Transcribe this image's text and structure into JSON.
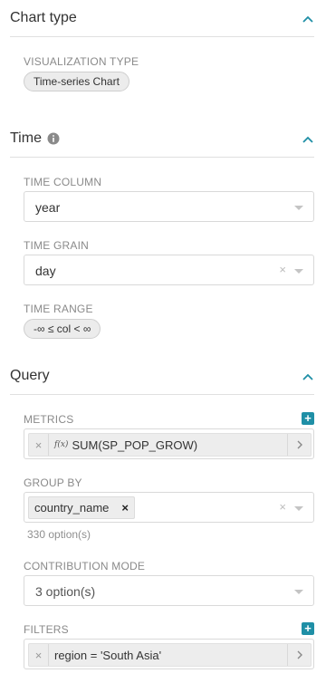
{
  "sections": {
    "chart_type": {
      "title": "Chart type"
    },
    "time": {
      "title": "Time"
    },
    "query": {
      "title": "Query"
    }
  },
  "visualization": {
    "label": "VISUALIZATION TYPE",
    "value": "Time-series Chart"
  },
  "time_column": {
    "label": "TIME COLUMN",
    "value": "year"
  },
  "time_grain": {
    "label": "TIME GRAIN",
    "value": "day",
    "clear": "×"
  },
  "time_range": {
    "label": "TIME RANGE",
    "value": "-∞ ≤ col < ∞"
  },
  "metrics": {
    "label": "METRICS",
    "remove": "×",
    "fx": "f(x)",
    "value": "SUM(SP_POP_GROW)",
    "add": "+"
  },
  "group_by": {
    "label": "GROUP BY",
    "token": "country_name",
    "remove": "×",
    "clear": "×",
    "options_hint": "330 option(s)"
  },
  "contribution": {
    "label": "CONTRIBUTION MODE",
    "value": "3 option(s)"
  },
  "filters": {
    "label": "FILTERS",
    "remove": "×",
    "value": "region = 'South Asia'",
    "add": "+"
  },
  "colors": {
    "accent": "#1f8fa6",
    "border": "#d9d9d9",
    "muted_label": "#8a8a8a"
  },
  "icons": [
    "chevron-up-icon",
    "info-icon",
    "caret-down-icon",
    "close-icon",
    "function-icon",
    "chevron-right-icon",
    "plus-icon"
  ]
}
